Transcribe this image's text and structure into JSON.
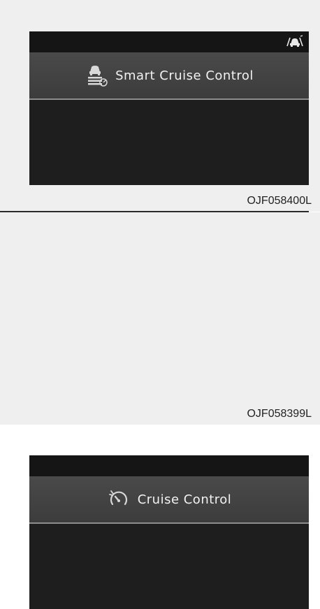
{
  "panels": [
    {
      "title": "Smart Cruise Control",
      "title_icon": "smart-cruise-control-icon",
      "status_icon": "front-vehicle-radar-icon",
      "code": "OJF058400L"
    },
    {
      "title": "Cruise Control",
      "title_icon": "cruise-control-icon",
      "code": "OJF058399L"
    }
  ],
  "colors": {
    "background": "#efefef",
    "screen": "#1e1e1e",
    "band": "#444444",
    "band_border": "#8e8e8e",
    "text": "#f2f2f2"
  }
}
